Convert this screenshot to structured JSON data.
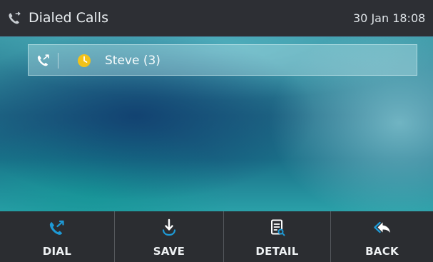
{
  "header": {
    "title": "Dialed Calls",
    "title_icon": "phone-history-icon",
    "clock": "30 Jan 18:08"
  },
  "call_list": [
    {
      "type_icon": "outgoing-call-icon",
      "status_icon": "clock-icon",
      "status_color": "#f2c21a",
      "label": "Steve (3)"
    }
  ],
  "softkeys": [
    {
      "label": "DIAL",
      "icon": "outgoing-call-icon"
    },
    {
      "label": "SAVE",
      "icon": "save-download-icon"
    },
    {
      "label": "DETAIL",
      "icon": "detail-document-icon"
    },
    {
      "label": "BACK",
      "icon": "back-arrow-icon"
    }
  ],
  "colors": {
    "accent_blue": "#1e9ad6",
    "bar_background": "#2b2d31"
  }
}
